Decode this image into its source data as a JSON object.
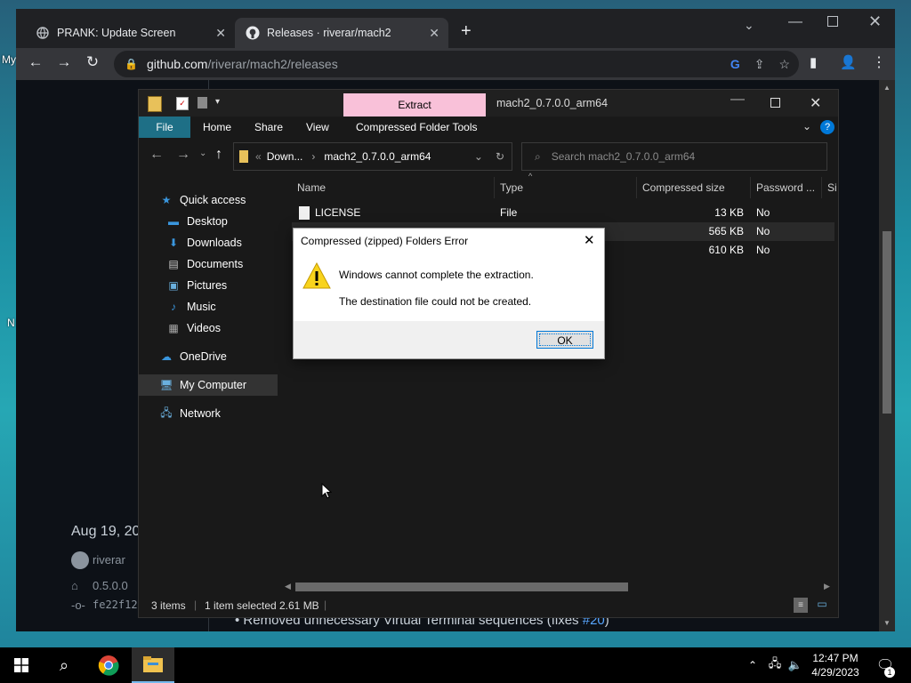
{
  "desktop": {
    "labels": [
      "My",
      "N"
    ]
  },
  "chrome": {
    "tabs": [
      {
        "label": "PRANK: Update Screen",
        "active": false
      },
      {
        "label": "Releases · riverar/mach2",
        "active": true
      }
    ],
    "url_host": "github.com",
    "url_path": "/riverar/mach2/releases",
    "page": {
      "release_date": "Aug 19, 20",
      "author": "riverar",
      "tag": "0.5.0.0",
      "commit": "fe22f12",
      "bullet": "Removed unnecessary Virtual Terminal sequences (fixes ",
      "issue_link": "#20",
      "bullet_end": ")"
    }
  },
  "explorer": {
    "contextual_tab": "Extract",
    "title": "mach2_0.7.0.0_arm64",
    "ribbon": [
      "File",
      "Home",
      "Share",
      "View",
      "Compressed Folder Tools"
    ],
    "breadcrumb": [
      "Down...",
      "mach2_0.7.0.0_arm64"
    ],
    "search_placeholder": "Search mach2_0.7.0.0_arm64",
    "nav": {
      "quick_access": "Quick access",
      "quick_items": [
        "Desktop",
        "Downloads",
        "Documents",
        "Pictures",
        "Music",
        "Videos"
      ],
      "onedrive": "OneDrive",
      "computer": "My Computer",
      "network": "Network"
    },
    "columns": [
      "Name",
      "Type",
      "Compressed size",
      "Password ...",
      "Si"
    ],
    "rows": [
      {
        "name": "LICENSE",
        "type": "File",
        "size": "13 KB",
        "password": "No"
      },
      {
        "name": "",
        "type": "",
        "size": "565 KB",
        "password": "No"
      },
      {
        "name": "",
        "type": "",
        "size": "610 KB",
        "password": "No"
      }
    ],
    "status": {
      "items": "3 items",
      "selected": "1 item selected",
      "size": "2.61 MB"
    }
  },
  "dialog": {
    "title": "Compressed (zipped) Folders Error",
    "message1": "Windows cannot complete the extraction.",
    "message2": "The destination file could not be created.",
    "ok_label": "OK"
  },
  "taskbar": {
    "time": "12:47 PM",
    "date": "4/29/2023",
    "notification_count": "1"
  },
  "colors": {
    "accent": "#0078d7",
    "extract_tab": "#f9c1d9",
    "file_tab": "#1e6f86",
    "link": "#58a6ff"
  }
}
